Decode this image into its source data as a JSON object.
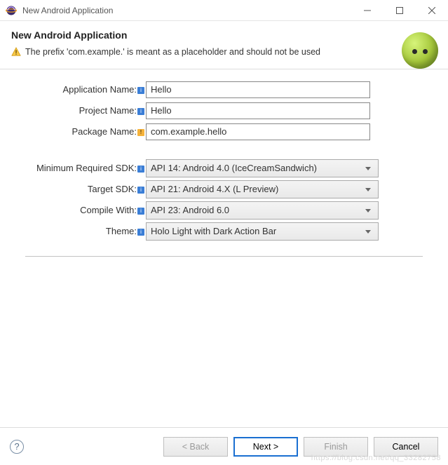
{
  "window": {
    "title": "New Android Application"
  },
  "header": {
    "title": "New Android Application",
    "warning": "The prefix 'com.example.' is meant as a placeholder and should not be used"
  },
  "form": {
    "appName": {
      "label": "Application Name:",
      "value": "Hello"
    },
    "projName": {
      "label": "Project Name:",
      "value": "Hello"
    },
    "pkgName": {
      "label": "Package Name:",
      "value": "com.example.hello"
    },
    "minSdk": {
      "label": "Minimum Required SDK:",
      "value": "API 14: Android 4.0 (IceCreamSandwich)"
    },
    "targetSdk": {
      "label": "Target SDK:",
      "value": "API 21: Android 4.X (L Preview)"
    },
    "compile": {
      "label": "Compile With:",
      "value": "API 23: Android 6.0"
    },
    "theme": {
      "label": "Theme:",
      "value": "Holo Light with Dark Action Bar"
    }
  },
  "buttons": {
    "back": "< Back",
    "next": "Next >",
    "finish": "Finish",
    "cancel": "Cancel"
  },
  "watermark": "https://blog.csdn.net/qq_33282758"
}
